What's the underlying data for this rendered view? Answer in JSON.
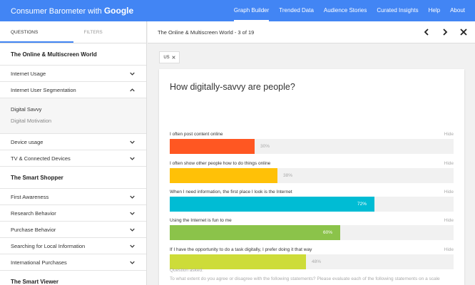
{
  "header": {
    "brand": "Consumer Barometer with",
    "brand_google": "Google",
    "nav": [
      {
        "label": "Graph Builder",
        "active": true
      },
      {
        "label": "Trended Data"
      },
      {
        "label": "Audience Stories"
      },
      {
        "label": "Curated Insights"
      },
      {
        "label": "Help"
      },
      {
        "label": "About"
      }
    ]
  },
  "sidebar": {
    "tabs": [
      "QUESTIONS",
      "FILTERS"
    ],
    "sections": [
      {
        "title": "The Online & Multiscreen World",
        "items": [
          {
            "label": "Internet Usage",
            "icon": "chevron-down-icon"
          },
          {
            "label": "Internet User Segmentation",
            "icon": "chevron-up-icon",
            "children": [
              "Digital Savvy",
              "Digital Motivation"
            ]
          },
          {
            "label": "Device usage",
            "icon": "chevron-down-icon"
          },
          {
            "label": "TV & Connected Devices",
            "icon": "chevron-down-icon"
          }
        ]
      },
      {
        "title": "The Smart Shopper",
        "items": [
          {
            "label": "First Awareness",
            "icon": "chevron-down-icon"
          },
          {
            "label": "Research Behavior",
            "icon": "chevron-down-icon"
          },
          {
            "label": "Purchase Behavior",
            "icon": "chevron-down-icon"
          },
          {
            "label": "Searching for Local Information",
            "icon": "chevron-down-icon"
          },
          {
            "label": "International Purchases",
            "icon": "chevron-down-icon"
          }
        ]
      },
      {
        "title": "The Smart Viewer",
        "items": []
      }
    ]
  },
  "main": {
    "title": "The Online & Multiscreen World - 3 of 19",
    "icons": [
      "chevron-left-icon",
      "chevron-right-icon",
      "close-icon"
    ],
    "chip": "US",
    "question": "How digitally-savvy are people?",
    "hide_label": "Hide",
    "items": [
      {
        "label": "I often post content online",
        "value": "30%",
        "fraction": 0.3,
        "color": "#ff5722"
      },
      {
        "label": "I often show other people how to do things online",
        "value": "38%",
        "fraction": 0.38,
        "color": "#ffc107"
      },
      {
        "label": "When I need information, the first place I look is the Internet",
        "value": "72%",
        "fraction": 0.72,
        "color": "#00bcd4"
      },
      {
        "label": "Using the Internet is fun to me",
        "value": "60%",
        "fraction": 0.6,
        "color": "#8bc34a"
      },
      {
        "label": "If I have the opportunity to do a task digitally, I prefer doing it that way",
        "value": "48%",
        "fraction": 0.48,
        "color": "#cddc39"
      }
    ],
    "question_asked_label": "Question asked:",
    "question_asked_text": "To what extent do you agree or disagree with the following statements? Please evaluate each of the following statements on a scale"
  },
  "colors": {
    "accent": "#4285f4"
  }
}
